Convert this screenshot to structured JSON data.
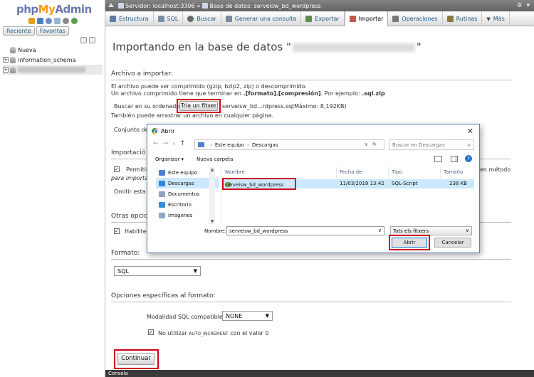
{
  "sidebar": {
    "logo_php": "php",
    "logo_my": "My",
    "logo_admin": "Admin",
    "tabs": [
      "Reciente",
      "Favoritas"
    ],
    "tree": [
      {
        "label": "Nueva"
      },
      {
        "label": "information_schema"
      }
    ]
  },
  "breadcrumb": {
    "server": "Servidor: localhost:3306",
    "sep": "»",
    "database": "Base de datos: serveisw_bd_wordpress"
  },
  "topmenu": {
    "tabs": [
      {
        "label": "Estructura",
        "icon": "structure-icon",
        "color": "#5b7fa8"
      },
      {
        "label": "SQL",
        "icon": "sql-icon",
        "color": "#7a8fa8"
      },
      {
        "label": "Buscar",
        "icon": "search-icon",
        "color": "#6a6a6a"
      },
      {
        "label": "Generar una consulta",
        "icon": "query-icon",
        "color": "#7c8aa0"
      },
      {
        "label": "Exportar",
        "icon": "export-icon",
        "color": "#5d8f4f"
      },
      {
        "label": "Importar",
        "icon": "import-icon",
        "color": "#c4574b"
      },
      {
        "label": "Operaciones",
        "icon": "wrench-icon",
        "color": "#777"
      },
      {
        "label": "Rutinas",
        "icon": "routines-icon",
        "color": "#8a7a3a"
      },
      {
        "label": "Más",
        "icon": "chevron-down-icon",
        "color": "#444"
      }
    ]
  },
  "main": {
    "title_prefix": "Importando en la base de datos \"",
    "title_suffix": "\"",
    "archivo": {
      "heading": "Archivo a importar:",
      "line1": "El archivo puede ser comprimido (gzip, bzip2, zip) o descomprimido.",
      "line2_a": "Un archivo comprimido tiene que terminar en ",
      "line2_b": ".[formato].[compresión]",
      "line2_c": ". Por ejemplo: ",
      "line2_d": ".sql.zip",
      "browse_label": "Buscar en su ordenador:",
      "browse_button": "Tria un fitxer",
      "chosen_file": "serveisw_bd...rdpress.sql",
      "max": "(Máximo: 8,192KB)",
      "drag_hint": "También puede arrastrar un archivo en cualquier página.",
      "charset_label": "Conjunto de c"
    },
    "importacion": {
      "heading": "Importació",
      "permit_label": "Permitir",
      "permit_suffix": "en método",
      "para_importar": "para importar",
      "omit_label": "Omitir esta ca"
    },
    "otras": {
      "heading": "Otras opcio",
      "habilite": "Habilite l"
    },
    "formato": {
      "heading": "Formato:",
      "value": "SQL"
    },
    "opciones": {
      "heading": "Opciones específicas al formato:",
      "modalidad_label": "Modalidad SQL compatible:",
      "modalidad_value": "NONE",
      "no_utilizar": "No utilizar",
      "auto_inc": "AUTO_INCREMENT",
      "con_valor": "con el valor 0"
    },
    "continuar": "Continuar"
  },
  "console": {
    "label": "Consola"
  },
  "dialog": {
    "title": "Abrir",
    "close": "✕",
    "address": {
      "root": "Este equipo",
      "folder": "Descargas"
    },
    "search_placeholder": "Buscar en Descargas",
    "organize": "Organizar ▾",
    "new_folder": "Nueva carpeta",
    "nav_items": [
      {
        "label": "Este equipo",
        "color": "#4d7fcf"
      },
      {
        "label": "Descargas",
        "color": "#2e86de"
      },
      {
        "label": "Documentos",
        "color": "#8fa3c0"
      },
      {
        "label": "Escritorio",
        "color": "#3c8dd6"
      },
      {
        "label": "Imágenes",
        "color": "#8aa8c8"
      }
    ],
    "columns": [
      "Nombre",
      "Fecha de modifica...",
      "Tipo",
      "Tamaño"
    ],
    "file": {
      "name": "serveisw_bd_wordpress",
      "date": "11/03/2019 13:42",
      "type": "SQL-Script",
      "size": "238 KB"
    },
    "name_label": "Nombre:",
    "name_value": "serveisw_bd_wordpress",
    "filter": "Tots els fitxers",
    "open_button": "Abrir",
    "cancel_button": "Cancelar"
  },
  "colors": {
    "highlight": "#d0021b",
    "pma_blue": "#235a81"
  }
}
